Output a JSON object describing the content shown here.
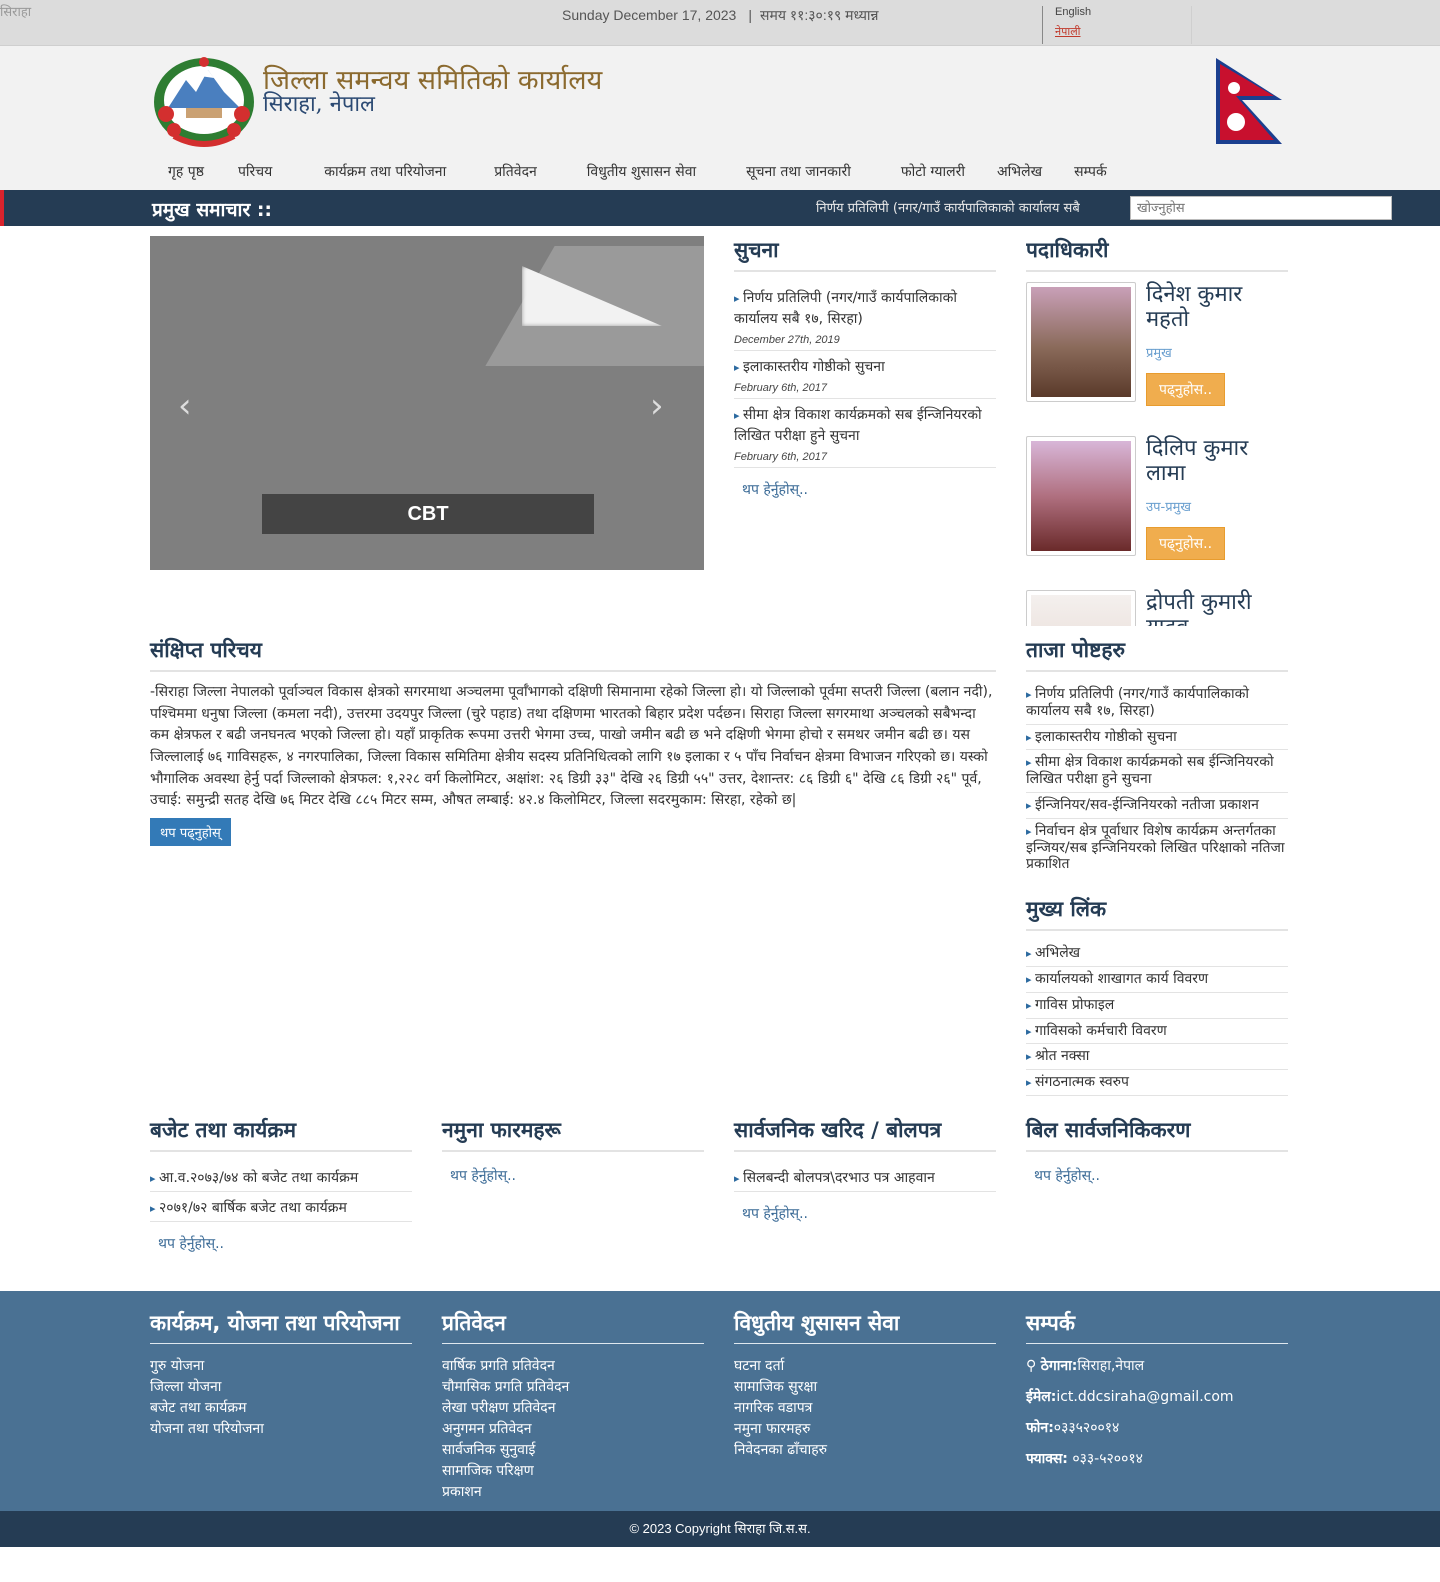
{
  "topbar": {
    "broken_image_alt": "सिराहा",
    "date": "Sunday December 17, 2023",
    "separator": "|",
    "time": "समय ११:३०:१९ मध्यान्न",
    "lang_english": "English",
    "lang_nepali": "नेपाली"
  },
  "header": {
    "title": "जिल्ला समन्वय समितिको कार्यालय",
    "subtitle": "सिराहा, नेपाल"
  },
  "nav": [
    "गृह पृष्ठ",
    "परिचय",
    "कार्यक्रम तथा परियोजना",
    "प्रतिवेदन",
    "विधुतीय शुसासन सेवा",
    "सूचना तथा जानकारी",
    "फोटो ग्यालरी",
    "अभिलेख",
    "सम्पर्क"
  ],
  "newsbar": {
    "label": "प्रमुख समाचार ::",
    "ticker": "निर्णय प्रतिलिपी (नगर/गाउँ कार्यपालिकाको कार्यालय सबै",
    "search_placeholder": "खोज्नुहोस"
  },
  "slider": {
    "caption": "CBT",
    "prev": "‹",
    "next": "›"
  },
  "notices": {
    "title": "सुचना",
    "items": [
      {
        "title": "निर्णय प्रतिलिपी (नगर/गाउँ कार्यपालिकाको कार्यालय सबै १७, सिरहा)",
        "date": "December 27th, 2019"
      },
      {
        "title": "इलाकास्तरीय गोष्ठीको सुचना",
        "date": "February 6th, 2017"
      },
      {
        "title": "सीमा क्षेत्र विकाश कार्यक्रमको सब ईन्जिनियरको लिखित परीक्षा हुने सुचना",
        "date": "February 6th, 2017"
      }
    ],
    "more": "थप हेर्नुहोस्.."
  },
  "officials": {
    "title": "पदाधिकारी",
    "items": [
      {
        "name": "दिनेश कुमार महतो",
        "role": "प्रमुख",
        "button": "पढ्नुहोस.."
      },
      {
        "name": "दिलिप कुमार लामा",
        "role": "उप-प्रमुख",
        "button": "पढ्नुहोस.."
      },
      {
        "name": "द्रोपती कुमारी यादव",
        "role": "",
        "button": ""
      }
    ]
  },
  "intro": {
    "title": "संक्षिप्त परिचय",
    "text": "-सिराहा जिल्ला नेपालको पूर्वाञ्चल विकास क्षेत्रको सगरमाथा अञ्चलमा पूर्वाँभागको दक्षिणी सिमानामा रहेको जिल्ला हो। यो जिल्लाको पूर्वमा सप्तरी जिल्ला (बलान नदी), पश्चिममा धनुषा जिल्ला (कमला नदी), उत्तरमा उदयपुर जिल्ला (चुरे पहाड) तथा दक्षिणमा भारतको बिहार प्रदेश पर्दछन। सिराहा जिल्ला सगरमाथा अञ्चलको सबैभन्दा कम क्षेत्रफल र बढी जनघनत्व भएको जिल्ला हो। यहाँ प्राकृतिक रूपमा उत्तरी भेगमा उच्च, पाखो जमीन बढी छ भने दक्षिणी भेगमा होचो र समथर जमीन बढी छ। यस जिल्लालाई ७६ गाविसहरू, ४ नगरपालिका, जिल्ला विकास समितिमा क्षेत्रीय सदस्य प्रतिनिधित्वको लागि १७ इलाका र ५ पाँच निर्वाचन क्षेत्रमा विभाजन गरिएको छ। यस्को भौगालिक अवस्था हेर्नु पर्दा जिल्लाको क्षेत्रफल: १,२२८ वर्ग किलोमिटर, अक्षांश: २६ डिग्री ३३\" देखि २६ डिग्री ५५\" उत्तर, देशान्तर: ८६ डिग्री ६\" देखि ८६ डिग्री २६\" पूर्व, उचाई: समुन्द्री सतह देखि ७६ मिटर देखि ८८५ मिटर सम्म, औषत लम्बाई: ४२.४ किलोमिटर, जिल्ला सदरमुकाम: सिरहा, रहेको छ|",
    "button": "थप पढ्नुहोस्"
  },
  "latest_posts": {
    "title": "ताजा पोष्टहरु",
    "items": [
      "निर्णय प्रतिलिपी (नगर/गाउँ कार्यपालिकाको कार्यालय सबै १७, सिरहा)",
      "इलाकास्तरीय गोष्ठीको सुचना",
      "सीमा क्षेत्र विकाश कार्यक्रमको सब ईन्जिनियरको लिखित परीक्षा हुने सुचना",
      "ईन्जिनियर/सव-ईन्जिनियरको नतीजा प्रकाशन",
      "निर्वाचन क्षेत्र पूर्वाधार विशेष कार्यक्रम अन्तर्गतका इन्जियर/सब इन्जिनियरको लिखित परिक्षाको नतिजा प्रकाशित"
    ]
  },
  "main_links": {
    "title": "मुख्य लिंक",
    "items": [
      "अभिलेख",
      "कार्यालयको शाखागत कार्य विवरण",
      "गाविस प्रोफाइल",
      "गाविसको कर्मचारी विवरण",
      "श्रोत नक्सा",
      "संगठनात्मक स्वरुप"
    ]
  },
  "budget": {
    "title": "बजेट तथा कार्यक्रम",
    "items": [
      "आ.व.२०७३/७४ को बजेट तथा कार्यक्रम",
      "२०७१/७२ बार्षिक बजेट तथा कार्यक्रम"
    ],
    "more": "थप हेर्नुहोस्.."
  },
  "forms": {
    "title": "नमुना फारमहरू",
    "items": [],
    "more": "थप हेर्नुहोस्.."
  },
  "procurement": {
    "title": "सार्वजनिक खरिद / बोलपत्र",
    "items": [
      "सिलबन्दी बोलपत्र\\दरभाउ पत्र आहवान"
    ],
    "more": "थप हेर्नुहोस्.."
  },
  "bills": {
    "title": "बिल सार्वजनिकिकरण",
    "items": [],
    "more": "थप हेर्नुहोस्.."
  },
  "footer": {
    "programs": {
      "title": "कार्यक्रम, योजना तथा परियोजना",
      "items": [
        "गुरु योजना",
        "जिल्ला योजना",
        "बजेट तथा कार्यक्रम",
        "योजना तथा परियोजना"
      ]
    },
    "reports": {
      "title": "प्रतिवेदन",
      "items": [
        "वार्षिक प्रगति प्रतिवेदन",
        "चौमासिक प्रगति प्रतिवेदन",
        "लेखा परीक्षण प्रतिवेदन",
        "अनुगमन प्रतिवेदन",
        "सार्वजनिक सुनुवाई",
        "सामाजिक परिक्षण",
        "प्रकाशन"
      ]
    },
    "egov": {
      "title": "विधुतीय शुसासन सेवा",
      "items": [
        "घटना दर्ता",
        "सामाजिक सुरक्षा",
        "नागरिक वडापत्र",
        "नमुना फारमहरु",
        "निवेदनका ढाँचाहरु"
      ]
    },
    "contact": {
      "title": "सम्पर्क",
      "address_label": "ठेगाना:",
      "address": "सिराहा,नेपाल",
      "email_label": "ईमेल:",
      "email": "ict.ddcsiraha@gmail.com",
      "phone_label": "फोन:",
      "phone": "०३३५२००१४",
      "fax_label": "फ्याक्स:",
      "fax": "०३३-५२००१४"
    }
  },
  "copyright": "© 2023 Copyright सिराहा जि.स.स.",
  "colors": {
    "header_bar": "#253c54",
    "footer": "#4a7193",
    "accent_button": "#f0ad4e",
    "primary_button": "#337ab7",
    "title_gold": "#8b6a2f"
  }
}
